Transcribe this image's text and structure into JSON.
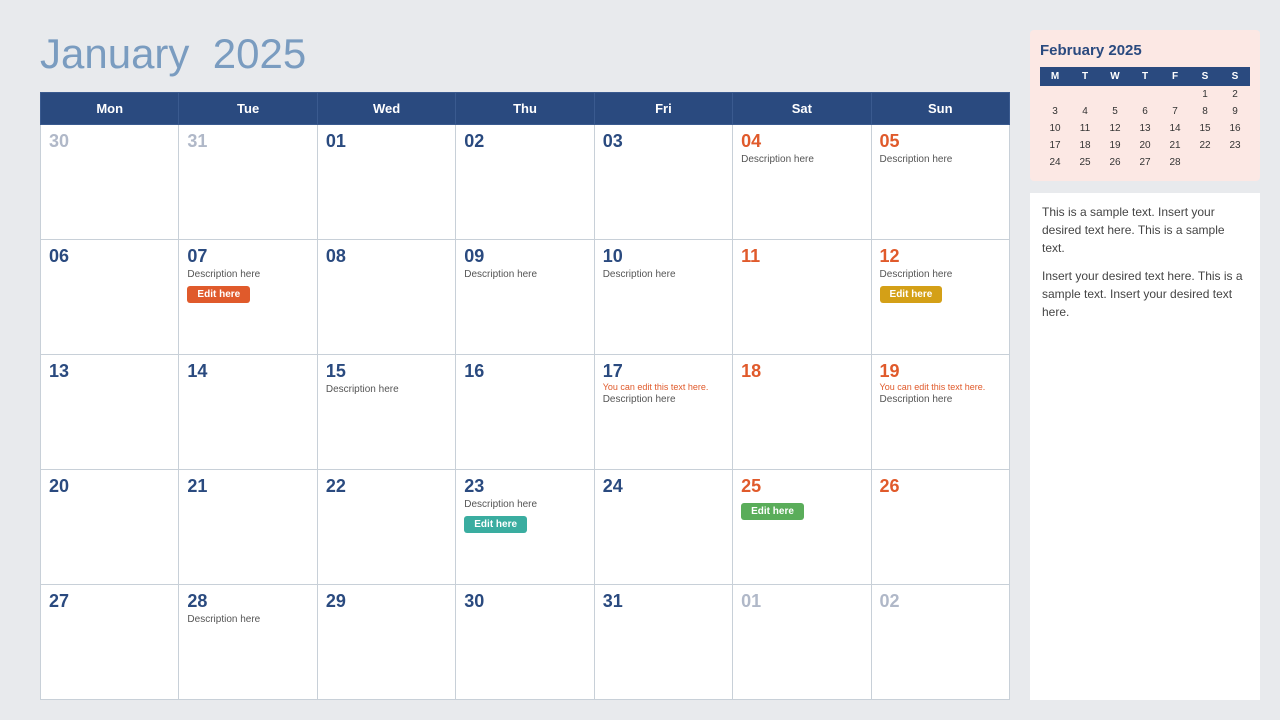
{
  "header": {
    "title_bold": "January",
    "title_light": "2025"
  },
  "calendar": {
    "days_of_week": [
      "Mon",
      "Tue",
      "Wed",
      "Thu",
      "Fri",
      "Sat",
      "Sun"
    ],
    "weeks": [
      [
        {
          "num": "30",
          "inactive": true
        },
        {
          "num": "31",
          "inactive": true
        },
        {
          "num": "01"
        },
        {
          "num": "02"
        },
        {
          "num": "03"
        },
        {
          "num": "04",
          "weekend": true,
          "desc": "Description here"
        },
        {
          "num": "05",
          "weekend": true,
          "desc": "Description here"
        }
      ],
      [
        {
          "num": "06"
        },
        {
          "num": "07",
          "desc": "Description here",
          "btn": "Edit here",
          "btn_color": "orange"
        },
        {
          "num": "08"
        },
        {
          "num": "09",
          "desc": "Description here"
        },
        {
          "num": "10",
          "desc": "Description here"
        },
        {
          "num": "11",
          "weekend": true
        },
        {
          "num": "12",
          "weekend": true,
          "desc": "Description here",
          "btn": "Edit here",
          "btn_color": "yellow"
        }
      ],
      [
        {
          "num": "13"
        },
        {
          "num": "14"
        },
        {
          "num": "15",
          "desc": "Description here"
        },
        {
          "num": "16"
        },
        {
          "num": "17",
          "note": "You can edit this text here.",
          "desc": "Description here"
        },
        {
          "num": "18",
          "weekend": true
        },
        {
          "num": "19",
          "weekend": true,
          "note": "You can edit this text here.",
          "desc": "Description here"
        }
      ],
      [
        {
          "num": "20"
        },
        {
          "num": "21"
        },
        {
          "num": "22"
        },
        {
          "num": "23",
          "desc": "Description here",
          "btn": "Edit here",
          "btn_color": "teal"
        },
        {
          "num": "24"
        },
        {
          "num": "25",
          "weekend": true,
          "btn": "Edit here",
          "btn_color": "green"
        },
        {
          "num": "26",
          "weekend": true
        }
      ],
      [
        {
          "num": "27"
        },
        {
          "num": "28",
          "desc": "Description here"
        },
        {
          "num": "29"
        },
        {
          "num": "30"
        },
        {
          "num": "31"
        },
        {
          "num": "01",
          "inactive": true
        },
        {
          "num": "02",
          "inactive": true
        }
      ]
    ]
  },
  "mini_calendar": {
    "title": "February 2025",
    "headers": [
      "M",
      "T",
      "W",
      "T",
      "F",
      "S",
      "S"
    ],
    "weeks": [
      [
        "",
        "",
        "",
        "",
        "",
        "1",
        "2"
      ],
      [
        "3",
        "4",
        "5",
        "6",
        "7",
        "8",
        "9"
      ],
      [
        "10",
        "11",
        "12",
        "13",
        "14",
        "15",
        "16"
      ],
      [
        "17",
        "18",
        "19",
        "20",
        "21",
        "22",
        "23"
      ],
      [
        "24",
        "25",
        "26",
        "27",
        "28",
        "",
        ""
      ]
    ]
  },
  "sidebar_texts": [
    "This is a sample text. Insert your desired text here. This is a sample text.",
    "Insert your desired text here. This is a sample text. Insert your desired text here."
  ],
  "btn_labels": {
    "edit": "Edit here"
  }
}
